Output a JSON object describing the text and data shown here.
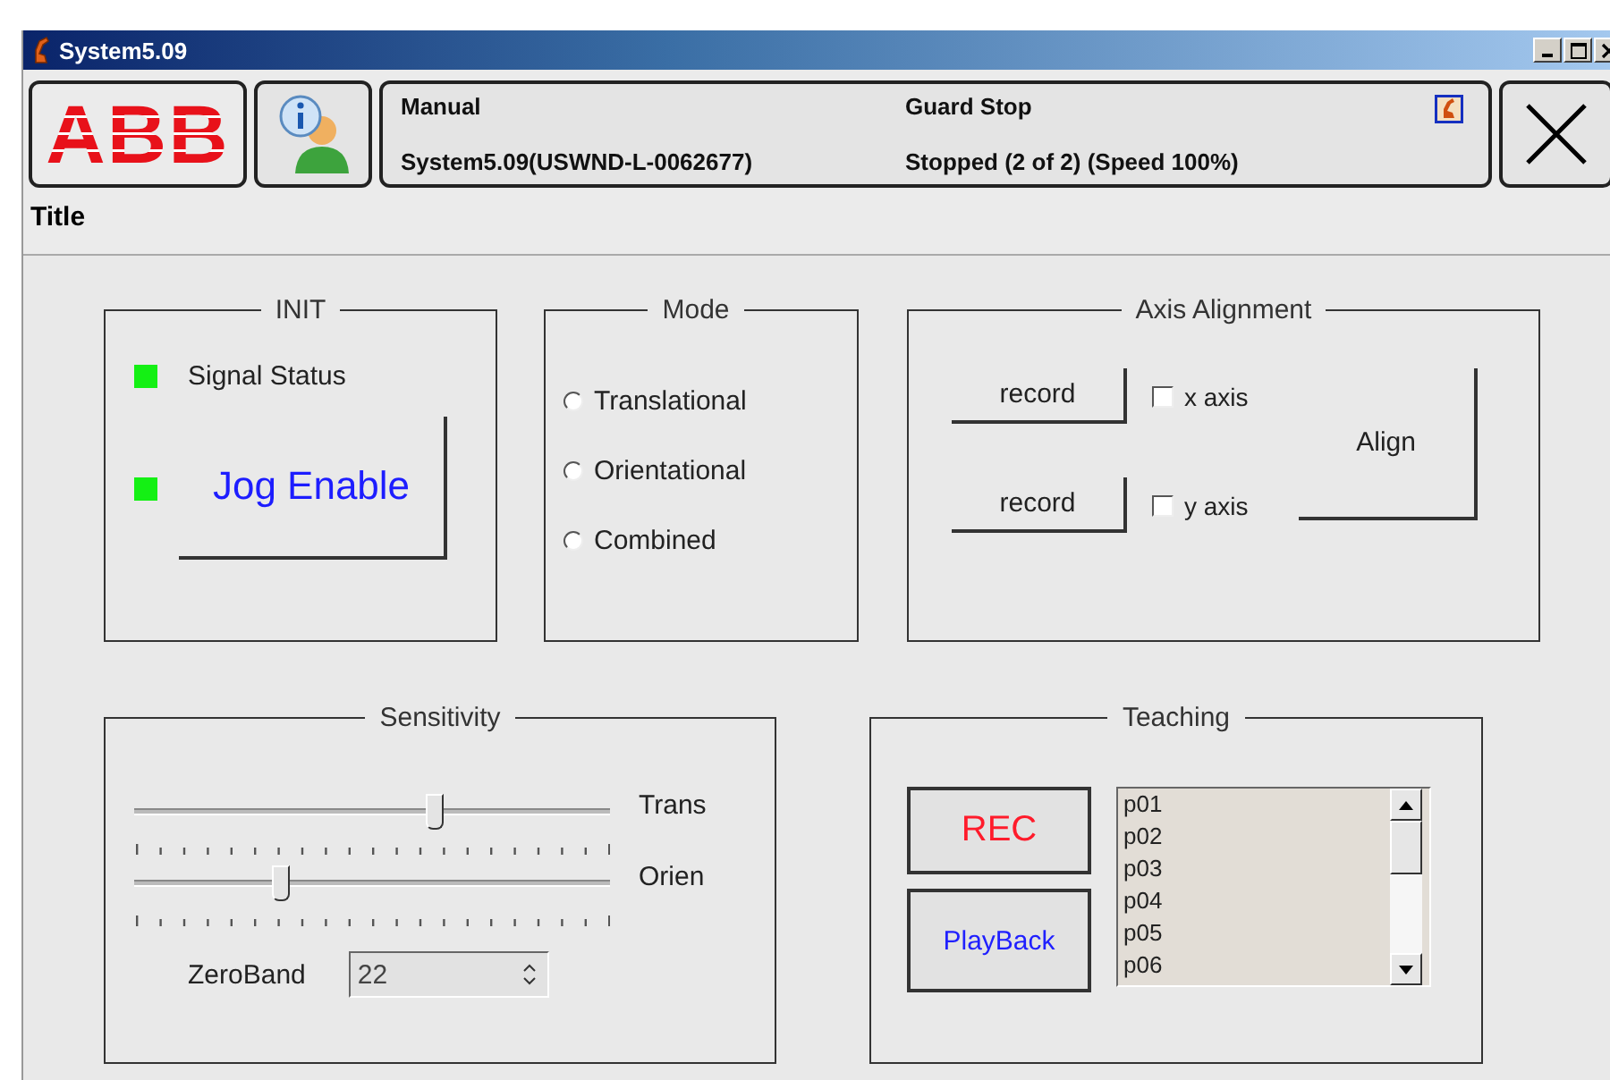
{
  "window": {
    "title": "System5.09"
  },
  "header": {
    "logo": "ABB",
    "mode": "Manual",
    "system": "System5.09(USWND-L-0062677)",
    "state": "Guard Stop",
    "status": "Stopped (2 of 2) (Speed 100%)"
  },
  "title": "Title",
  "init": {
    "legend": "INIT",
    "indicators": [
      {
        "kind": "label",
        "label": "Signal Status",
        "on": true
      },
      {
        "kind": "button",
        "label": "Jog Enable",
        "on": true
      }
    ]
  },
  "mode": {
    "legend": "Mode",
    "options": [
      {
        "label": "Translational",
        "selected": false
      },
      {
        "label": "Orientational",
        "selected": false
      },
      {
        "label": "Combined",
        "selected": false
      }
    ]
  },
  "axis_alignment": {
    "legend": "Axis Alignment",
    "rows": [
      {
        "button": "record",
        "label": "x axis",
        "checked": false
      },
      {
        "button": "record",
        "label": "y axis",
        "checked": false
      }
    ],
    "align_button": "Align"
  },
  "sensitivity": {
    "legend": "Sensitivity",
    "sliders": [
      {
        "label": "Trans",
        "level": 0.63
      },
      {
        "label": "Orien",
        "level": 0.31
      }
    ],
    "zero_band": {
      "label": "ZeroBand",
      "value": "22"
    }
  },
  "teaching": {
    "legend": "Teaching",
    "rec_button": "REC",
    "playback_button": "PlayBack",
    "points": [
      {
        "label": "p01",
        "selected": false
      },
      {
        "label": "p02",
        "selected": false
      },
      {
        "label": "p03",
        "selected": false
      },
      {
        "label": "p04",
        "selected": false
      },
      {
        "label": "p05",
        "selected": false
      },
      {
        "label": "p06",
        "selected": false
      }
    ]
  }
}
